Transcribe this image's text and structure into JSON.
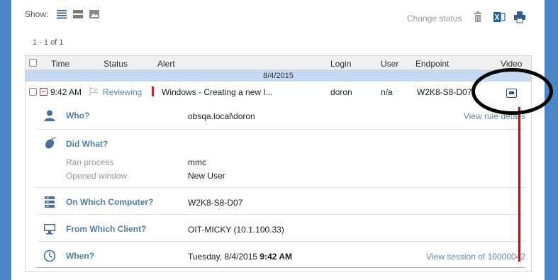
{
  "toolbar": {
    "show_label": "Show:",
    "change_status": "Change status"
  },
  "pager": {
    "text": "1 - 1 of 1"
  },
  "table": {
    "headers": {
      "time": "Time",
      "status": "Status",
      "alert": "Alert",
      "login": "Login",
      "user": "User",
      "endpoint": "Endpoint",
      "video": "Video"
    },
    "date_group": "8/4/2015",
    "row": {
      "time": "9:42 AM",
      "status": "Reviewing",
      "alert": "Windows - Creating a new I...",
      "login": "doron",
      "user": "n/a",
      "endpoint": "W2K8-S8-D07"
    }
  },
  "details": {
    "who": {
      "label": "Who?",
      "value": "obsqa.local\\doron",
      "link": "View rule details"
    },
    "did_what": {
      "label": "Did What?",
      "items": [
        {
          "key": "Ran process",
          "value": "mmc"
        },
        {
          "key": "Opened window",
          "value": "New User"
        }
      ]
    },
    "computer": {
      "label": "On Which Computer?",
      "value": "W2K8-S8-D07"
    },
    "client": {
      "label": "From Which Client?",
      "value": "OIT-MICKY (10.1.100.33)"
    },
    "when": {
      "label": "When?",
      "value_date": "Tuesday, 8/4/2015",
      "value_time": "9:42 AM",
      "link": "View session of 10000042"
    }
  },
  "colors": {
    "frame": "#4b86c6",
    "link": "#5b88b8",
    "label": "#4f7fb0",
    "date_band": "#c5daf0",
    "severity": "#e02020"
  }
}
